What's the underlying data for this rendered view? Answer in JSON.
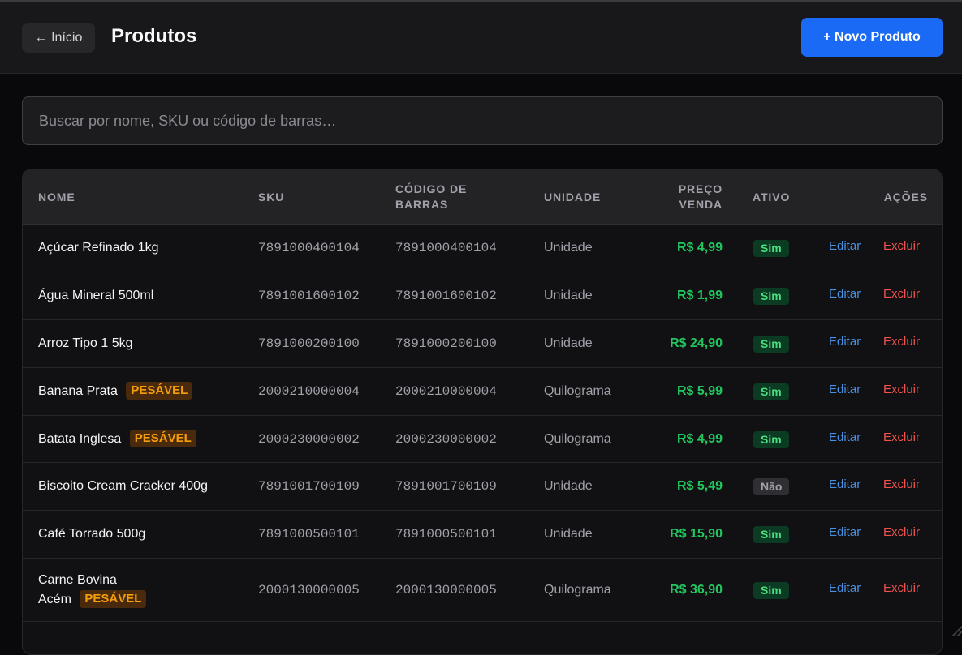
{
  "header": {
    "back_label": "← Início",
    "title": "Produtos",
    "new_label": "+ Novo Produto"
  },
  "search": {
    "placeholder": "Buscar por nome, SKU ou código de barras…"
  },
  "table": {
    "columns": {
      "name": "NOME",
      "sku": "SKU",
      "barcode_line1": "CÓDIGO DE",
      "barcode_line2": "BARRAS",
      "unit": "UNIDADE",
      "price_line1": "PREÇO",
      "price_line2": "VENDA",
      "active": "ATIVO",
      "actions": "AÇÕES"
    },
    "actions": {
      "edit": "Editar",
      "delete": "Excluir"
    },
    "weighable_badge": "PESÁVEL",
    "rows": [
      {
        "name": "Açúcar Refinado 1kg",
        "sku": "7891000400104",
        "barcode": "7891000400104",
        "unit": "Unidade",
        "price": "R$ 4,99",
        "active": "Sim"
      },
      {
        "name": "Água Mineral 500ml",
        "sku": "7891001600102",
        "barcode": "7891001600102",
        "unit": "Unidade",
        "price": "R$ 1,99",
        "active": "Sim"
      },
      {
        "name": "Arroz Tipo 1 5kg",
        "sku": "7891000200100",
        "barcode": "7891000200100",
        "unit": "Unidade",
        "price": "R$ 24,90",
        "active": "Sim"
      },
      {
        "name": "Banana Prata",
        "sku": "2000210000004",
        "barcode": "2000210000004",
        "unit": "Quilograma",
        "price": "R$ 5,99",
        "active": "Sim"
      },
      {
        "name": "Batata Inglesa",
        "sku": "2000230000002",
        "barcode": "2000230000002",
        "unit": "Quilograma",
        "price": "R$ 4,99",
        "active": "Sim"
      },
      {
        "name": "Biscoito Cream Cracker 400g",
        "sku": "7891001700109",
        "barcode": "7891001700109",
        "unit": "Unidade",
        "price": "R$ 5,49",
        "active": "Não"
      },
      {
        "name": "Café Torrado 500g",
        "sku": "7891000500101",
        "barcode": "7891000500101",
        "unit": "Unidade",
        "price": "R$ 15,90",
        "active": "Sim"
      },
      {
        "name_line1": "Carne Bovina",
        "name_line2": "Acém",
        "sku": "2000130000005",
        "barcode": "2000130000005",
        "unit": "Quilograma",
        "price": "R$ 36,90",
        "active": "Sim"
      }
    ]
  },
  "colors": {
    "accent": "#1a6af5",
    "price": "#22c55e",
    "active_yes": "#4ade80",
    "weighable": "#f59e0b",
    "edit": "#4a90e2",
    "delete": "#ef5350"
  }
}
